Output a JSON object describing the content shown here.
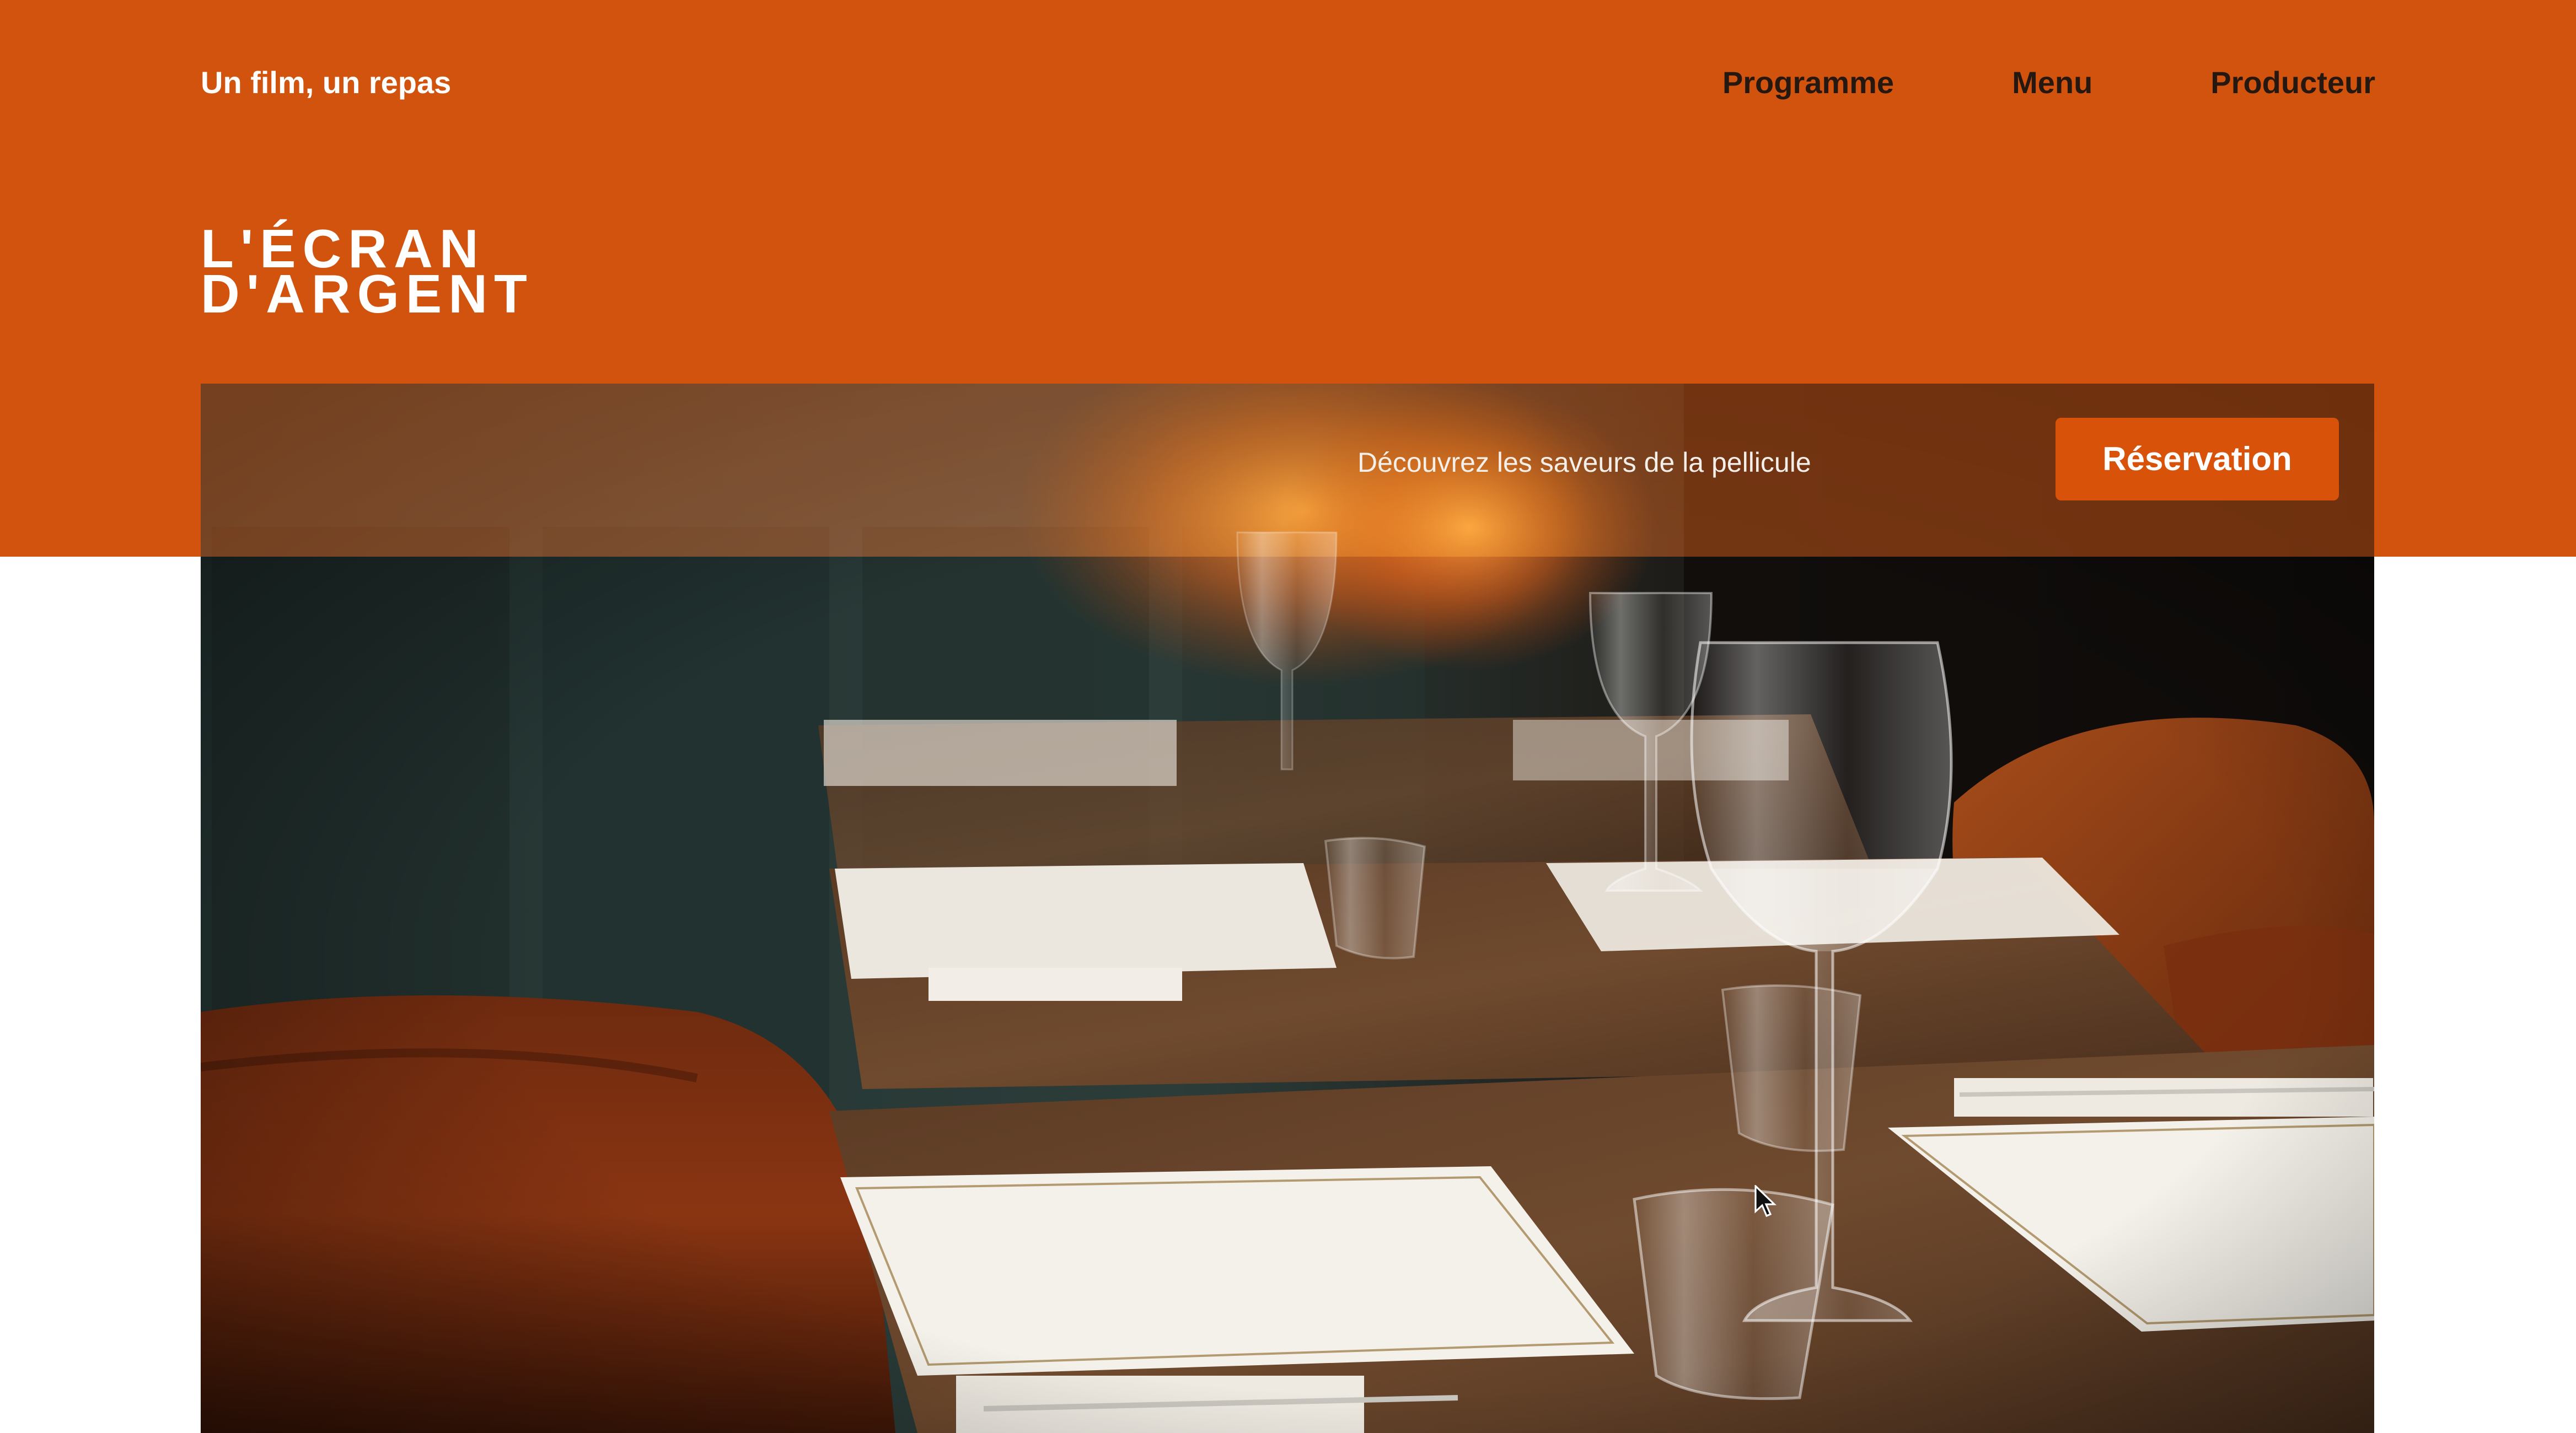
{
  "site": {
    "tagline": "Un film, un repas",
    "logo_line1": "L'ÉCRAN",
    "logo_line2": "D'ARGENT"
  },
  "nav": {
    "items": [
      {
        "label": "Programme"
      },
      {
        "label": "Menu"
      },
      {
        "label": "Producteur"
      }
    ]
  },
  "hero": {
    "tagline": "Découvrez les saveurs de la pellicule",
    "cta_label": "Réservation",
    "image_subject": "restaurant-table-setting-photo"
  },
  "colors": {
    "brand_orange": "#d2530d",
    "button_orange": "#d8520a",
    "nav_text": "#241811",
    "page_background": "#ffffff"
  },
  "icons": {
    "cursor": "mouse-pointer-icon"
  }
}
